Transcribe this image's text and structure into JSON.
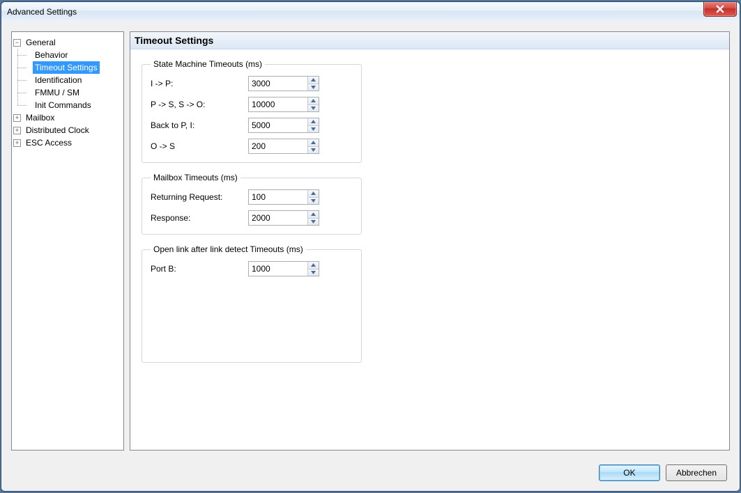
{
  "window": {
    "title": "Advanced Settings"
  },
  "tree": {
    "general": {
      "label": "General",
      "behavior": "Behavior",
      "timeout_settings": "Timeout Settings",
      "identification": "Identification",
      "fmmu_sm": "FMMU / SM",
      "init_commands": "Init Commands"
    },
    "mailbox": "Mailbox",
    "distributed_clock": "Distributed Clock",
    "esc_access": "ESC Access"
  },
  "panel": {
    "title": "Timeout Settings",
    "group_state": {
      "legend": "State Machine Timeouts (ms)",
      "i_to_p_label": "I -> P:",
      "i_to_p_value": "3000",
      "p_to_s_label": "P -> S, S -> O:",
      "p_to_s_value": "10000",
      "back_label": "Back to P, I:",
      "back_value": "5000",
      "o_to_s_label": "O -> S",
      "o_to_s_value": "200"
    },
    "group_mailbox": {
      "legend": "Mailbox Timeouts (ms)",
      "ret_req_label": "Returning Request:",
      "ret_req_value": "100",
      "response_label": "Response:",
      "response_value": "2000"
    },
    "group_link": {
      "legend": "Open link after link detect Timeouts (ms)",
      "portb_label": "Port B:",
      "portb_value": "1000"
    }
  },
  "buttons": {
    "ok": "OK",
    "cancel": "Abbrechen"
  }
}
